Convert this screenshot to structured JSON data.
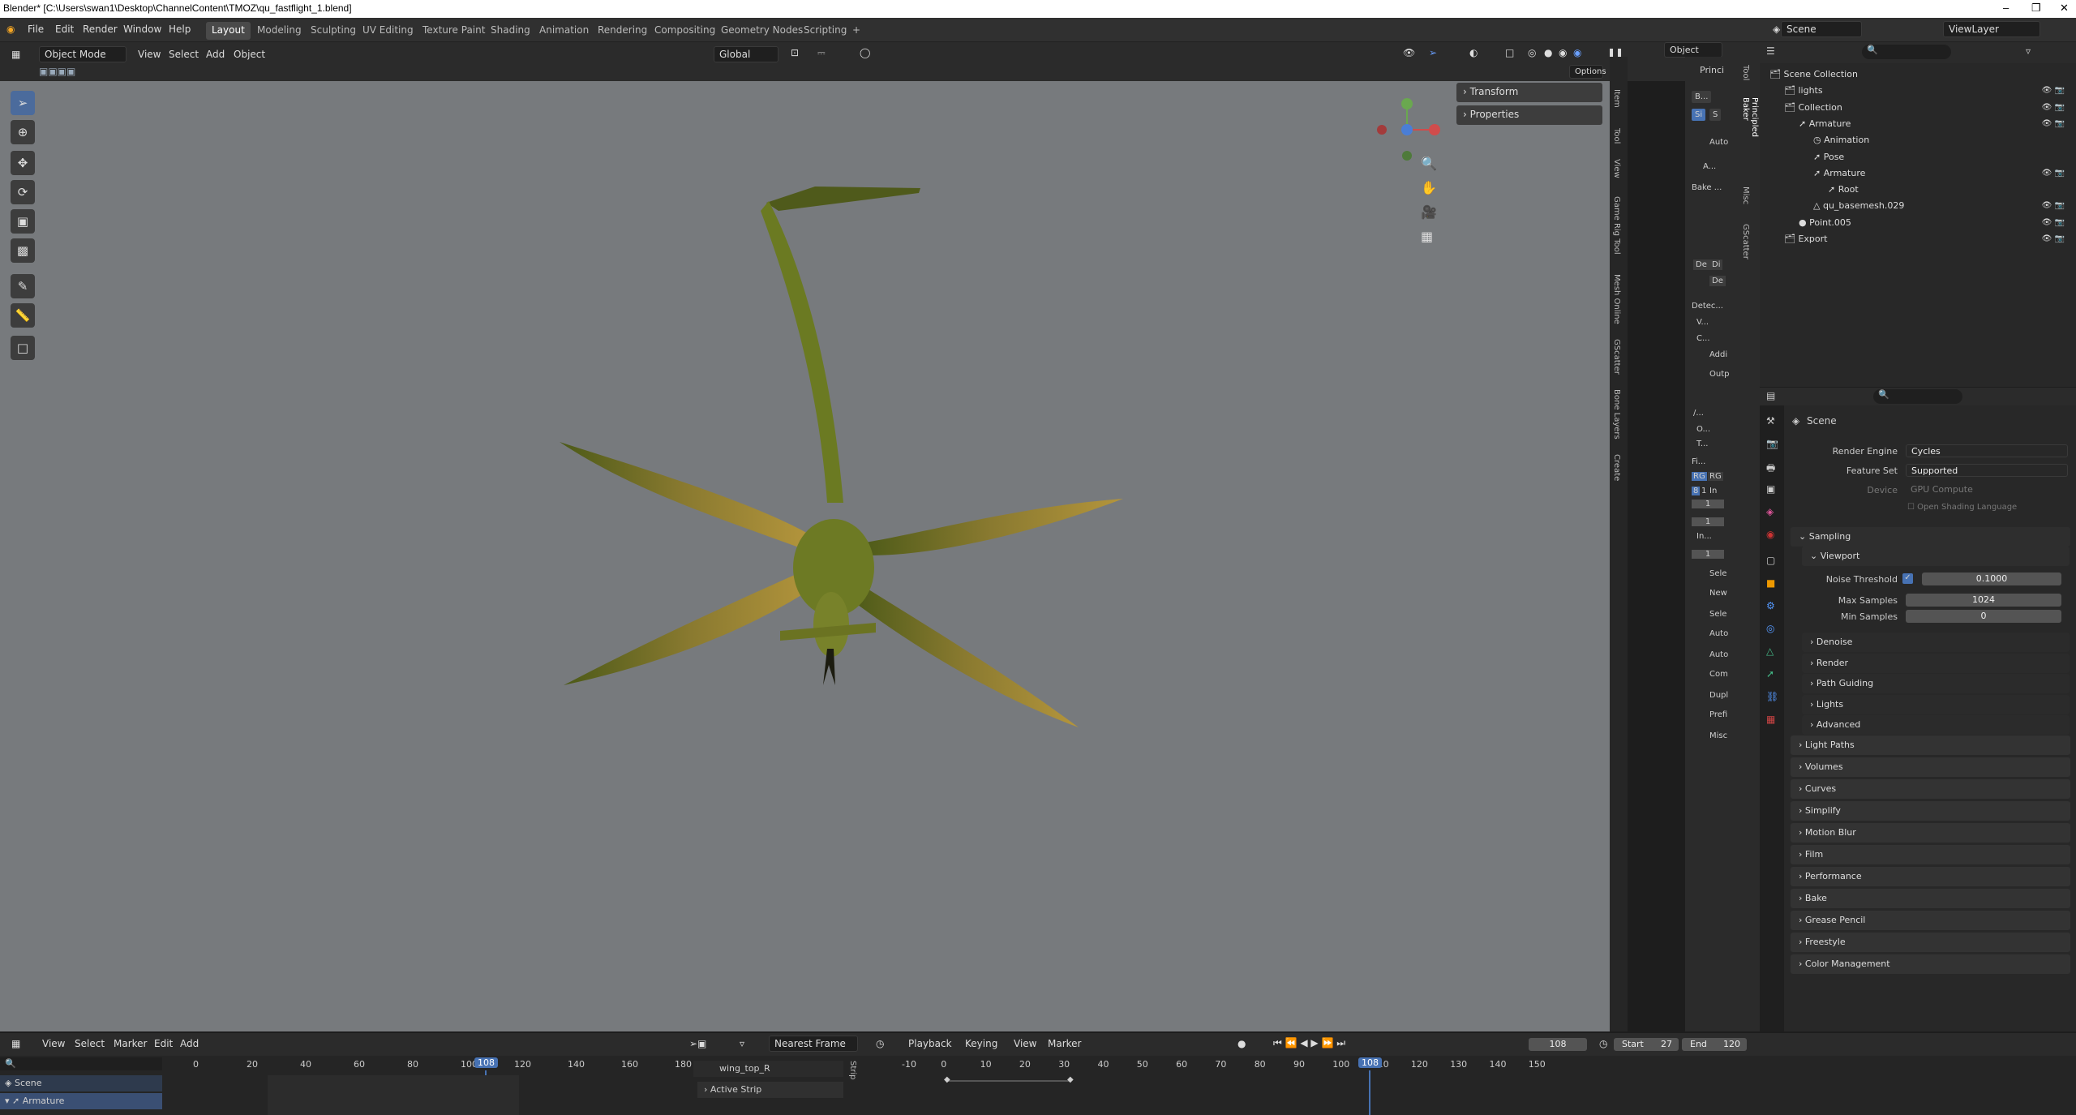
{
  "title": "Blender* [C:\\Users\\swan1\\Desktop\\ChannelContent\\TMOZ\\qu_fastflight_1.blend]",
  "menu": [
    "File",
    "Edit",
    "Render",
    "Window",
    "Help"
  ],
  "workspaces": [
    "Layout",
    "Modeling",
    "Sculpting",
    "UV Editing",
    "Texture Paint",
    "Shading",
    "Animation",
    "Rendering",
    "Compositing",
    "Geometry Nodes",
    "Scripting",
    "+"
  ],
  "scene": {
    "label": "Scene",
    "viewlayer": "ViewLayer"
  },
  "viewport_header": {
    "mode": "Object Mode",
    "menus": [
      "View",
      "Select",
      "Add",
      "Object"
    ],
    "orientation": "Global",
    "options": "Options",
    "object_dd": "Object"
  },
  "npanel": {
    "items": [
      "Transform",
      "Properties"
    ]
  },
  "vtabs": [
    "Item",
    "Tool",
    "View",
    "Game Rig Tool",
    "Mesh Online",
    "GScatter",
    "Bone Layers",
    "Create"
  ],
  "sidepanel": {
    "title": "Princi",
    "items": [
      "B...",
      "Si",
      "S",
      "Auto",
      "A...",
      "Bake ...",
      "Detec...",
      "V...",
      "C...",
      "Addi",
      "Outp",
      "/...",
      "O...",
      "T...",
      "Fi...",
      "RG",
      "RG",
      "8",
      "1",
      "In",
      "1",
      "1",
      "In...",
      "1",
      "Sele",
      "New",
      "Sele",
      "Auto",
      "Auto",
      "Com",
      "Dupl",
      "Prefi",
      "Misc",
      "De",
      "Di",
      "De"
    ],
    "tabs": [
      "Tool",
      "Principled Baker",
      "Misc",
      "GScatter"
    ]
  },
  "outliner": {
    "rows": [
      {
        "label": "Scene Collection",
        "indent": 0
      },
      {
        "label": "lights",
        "indent": 1
      },
      {
        "label": "Collection",
        "indent": 1
      },
      {
        "label": "Armature",
        "indent": 2
      },
      {
        "label": "Animation",
        "indent": 3
      },
      {
        "label": "Pose",
        "indent": 3
      },
      {
        "label": "Armature",
        "indent": 3
      },
      {
        "label": "Root",
        "indent": 4
      },
      {
        "label": "qu_basemesh.029",
        "indent": 3
      },
      {
        "label": "Point.005",
        "indent": 2
      },
      {
        "label": "Export",
        "indent": 1
      }
    ]
  },
  "properties": {
    "scene": "Scene",
    "render_engine_label": "Render Engine",
    "render_engine": "Cycles",
    "feature_set_label": "Feature Set",
    "feature_set": "Supported",
    "device_label": "Device",
    "device": "GPU Compute",
    "osl": "Open Shading Language",
    "sampling": "Sampling",
    "viewport": "Viewport",
    "noise_label": "Noise Threshold",
    "noise": "0.1000",
    "max_label": "Max Samples",
    "max": "1024",
    "min_label": "Min Samples",
    "min": "0",
    "sub": [
      "Denoise",
      "Render",
      "Path Guiding",
      "Lights",
      "Advanced"
    ],
    "sections": [
      "Light Paths",
      "Volumes",
      "Curves",
      "Simplify",
      "Motion Blur",
      "Film",
      "Performance",
      "Bake",
      "Grease Pencil",
      "Freestyle",
      "Color Management"
    ]
  },
  "dopesheet": {
    "menus": [
      "View",
      "Select",
      "Marker",
      "Edit",
      "Add"
    ],
    "ticks": [
      "0",
      "20",
      "40",
      "60",
      "80",
      "100",
      "120",
      "140",
      "160",
      "180"
    ],
    "frame": "108",
    "rows": [
      "Scene",
      "Armature"
    ]
  },
  "nla": {
    "snap": "Nearest Frame",
    "strip": "wing_top_R",
    "active": "Active Strip",
    "tab": "Strip"
  },
  "timeline": {
    "menus": [
      "Playback",
      "Keying",
      "View",
      "Marker"
    ],
    "ticks": [
      "-10",
      "0",
      "10",
      "20",
      "30",
      "40",
      "50",
      "60",
      "70",
      "80",
      "90",
      "100",
      "110",
      "120",
      "130",
      "140",
      "150"
    ],
    "current": "108",
    "start_label": "Start",
    "start": "27",
    "end_label": "End",
    "end": "120"
  },
  "colors": {
    "accent": "#4772b3",
    "viewport_bg": "#777a7d"
  }
}
